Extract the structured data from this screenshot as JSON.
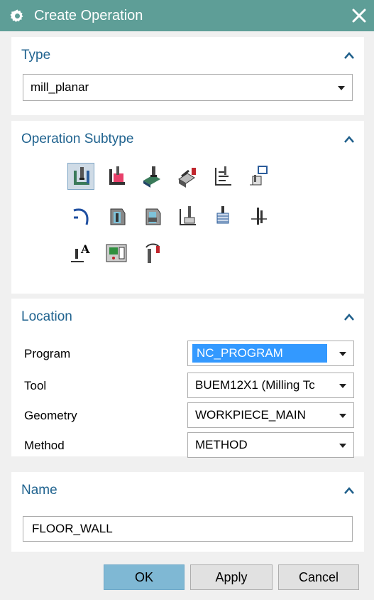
{
  "window": {
    "title": "Create Operation",
    "icon": "gear-icon",
    "accent": "#5e9e97"
  },
  "type_section": {
    "title": "Type",
    "selected": "mill_planar"
  },
  "subtype_section": {
    "title": "Operation Subtype",
    "icons": [
      "floor-wall-icon",
      "floor-wall-ipw-icon",
      "face-milling-icon",
      "face-milling-manual-icon",
      "planar-mill-icon",
      "planar-profile-icon",
      "cleanup-corners-icon",
      "finish-walls-icon",
      "finish-floor-icon",
      "groove-milling-icon",
      "hole-milling-icon",
      "thread-milling-icon",
      "planar-text-icon",
      "mill-control-icon",
      "mill-user-icon"
    ],
    "selected_index": 0
  },
  "location_section": {
    "title": "Location",
    "fields": [
      {
        "label": "Program",
        "value": "NC_PROGRAM",
        "highlighted": true
      },
      {
        "label": "Tool",
        "value": "BUEM12X1 (Milling Tc"
      },
      {
        "label": "Geometry",
        "value": "WORKPIECE_MAIN"
      },
      {
        "label": "Method",
        "value": "METHOD"
      }
    ]
  },
  "name_section": {
    "title": "Name",
    "value": "FLOOR_WALL"
  },
  "buttons": {
    "ok": "OK",
    "apply": "Apply",
    "cancel": "Cancel"
  },
  "colors": {
    "section_title": "#20638f",
    "ok_button": "#7fb8d4",
    "selection": "#3399ff"
  }
}
